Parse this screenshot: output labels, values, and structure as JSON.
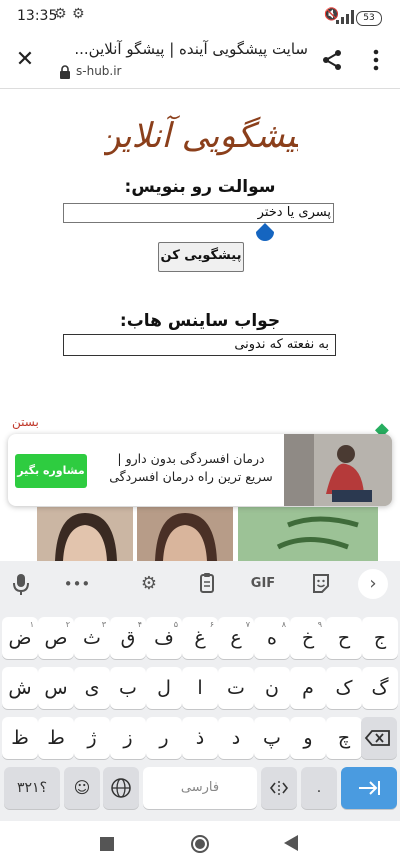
{
  "status_bar": {
    "time": "13:35",
    "battery": "53",
    "icons": [
      "gear-icon",
      "gear-icon",
      "mute-icon",
      "signal-icon",
      "battery-icon"
    ]
  },
  "browser": {
    "title": "سایت پیشگویی آینده | پیشگو آنلاین...",
    "url": "s-hub.ir",
    "icons": [
      "close-icon",
      "lock-icon",
      "share-icon",
      "more-icon"
    ]
  },
  "page": {
    "logo_text": "پیشگویی آنلاین",
    "question_label": "سوالت رو بنویس:",
    "question_value": "پسری یا دختر",
    "predict_button": "پیشگویی کن",
    "answer_label": "جواب ساینس هاب:",
    "answer_value": "به نفعته که ندونی"
  },
  "ad": {
    "close_label": "بستن",
    "text": "درمان افسردگی بدون دارو | سریع ترین راه درمان افسردگی",
    "button": "مشاوره بگیر"
  },
  "keyboard": {
    "toolbar": [
      "mic-icon",
      "more-icon",
      "gear-icon",
      "clipboard-icon",
      "GIF",
      "sticker-icon",
      "chevron-right-icon"
    ],
    "gif_label": "GIF",
    "row1": [
      "ج",
      "ح",
      "خ",
      "ه",
      "ع",
      "غ",
      "ف",
      "ق",
      "ث",
      "ص",
      "ض"
    ],
    "row1_numbers": [
      "",
      "",
      "۹",
      "۸",
      "۷",
      "۶",
      "۵",
      "۴",
      "۳",
      "۲",
      "۱"
    ],
    "row2": [
      "گ",
      "ک",
      "م",
      "ن",
      "ت",
      "ا",
      "ل",
      "ب",
      "ی",
      "س",
      "ش"
    ],
    "row3": [
      "چ",
      "و",
      "پ",
      "د",
      "ذ",
      "ر",
      "ز",
      "ژ",
      "ط",
      "ظ"
    ],
    "numbers_key": "؟۳۲۱",
    "space_label": "فارسی",
    "period": ".",
    "comma": "،"
  },
  "nav_bar": {
    "icons": [
      "recents-square-icon",
      "home-circle-icon",
      "back-triangle-icon"
    ]
  }
}
